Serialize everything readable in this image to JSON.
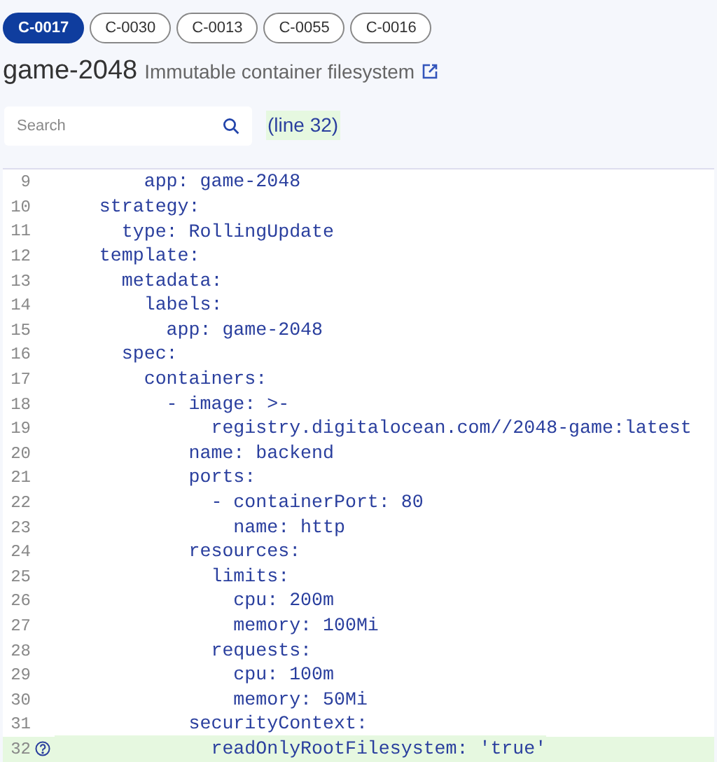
{
  "controls": [
    {
      "label": "C-0017",
      "selected": true
    },
    {
      "label": "C-0030",
      "selected": false
    },
    {
      "label": "C-0013",
      "selected": false
    },
    {
      "label": "C-0055",
      "selected": false
    },
    {
      "label": "C-0016",
      "selected": false
    }
  ],
  "heading": {
    "resource": "game-2048",
    "control_name": "Immutable container filesystem"
  },
  "search": {
    "placeholder": "Search"
  },
  "match": "(line 32)",
  "code_lines": [
    {
      "number": "9",
      "text": "        app: game-2048",
      "highlighted": false
    },
    {
      "number": "10",
      "text": "    strategy:",
      "highlighted": false
    },
    {
      "number": "11",
      "text": "      type: RollingUpdate",
      "highlighted": false
    },
    {
      "number": "12",
      "text": "    template:",
      "highlighted": false
    },
    {
      "number": "13",
      "text": "      metadata:",
      "highlighted": false
    },
    {
      "number": "14",
      "text": "        labels:",
      "highlighted": false
    },
    {
      "number": "15",
      "text": "          app: game-2048",
      "highlighted": false
    },
    {
      "number": "16",
      "text": "      spec:",
      "highlighted": false
    },
    {
      "number": "17",
      "text": "        containers:",
      "highlighted": false
    },
    {
      "number": "18",
      "text": "          - image: >-",
      "highlighted": false
    },
    {
      "number": "19",
      "text": "              registry.digitalocean.com//2048-game:latest",
      "highlighted": false
    },
    {
      "number": "20",
      "text": "            name: backend",
      "highlighted": false
    },
    {
      "number": "21",
      "text": "            ports:",
      "highlighted": false
    },
    {
      "number": "22",
      "text": "              - containerPort: 80",
      "highlighted": false
    },
    {
      "number": "23",
      "text": "                name: http",
      "highlighted": false
    },
    {
      "number": "24",
      "text": "            resources:",
      "highlighted": false
    },
    {
      "number": "25",
      "text": "              limits:",
      "highlighted": false
    },
    {
      "number": "26",
      "text": "                cpu: 200m",
      "highlighted": false
    },
    {
      "number": "27",
      "text": "                memory: 100Mi",
      "highlighted": false
    },
    {
      "number": "28",
      "text": "              requests:",
      "highlighted": false
    },
    {
      "number": "29",
      "text": "                cpu: 100m",
      "highlighted": false
    },
    {
      "number": "30",
      "text": "                memory: 50Mi",
      "highlighted": false
    },
    {
      "number": "31",
      "text": "            securityContext:",
      "highlighted": false
    },
    {
      "number": "32",
      "text": "              readOnlyRootFilesystem: 'true'",
      "highlighted": true
    }
  ]
}
